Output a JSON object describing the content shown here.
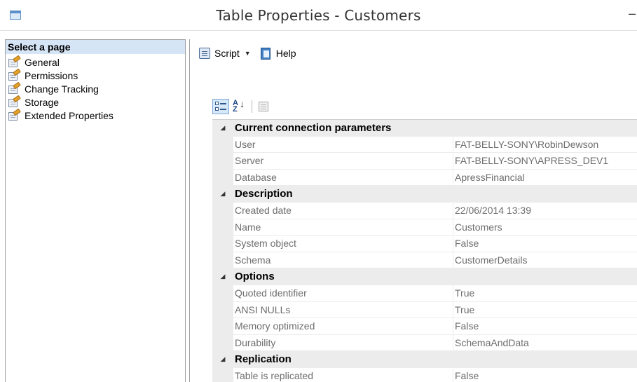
{
  "window": {
    "title": "Table Properties - Customers",
    "minimize_glyph": "–"
  },
  "left_pane": {
    "header": "Select a page",
    "pages": [
      {
        "label": "General",
        "selected": true
      },
      {
        "label": "Permissions",
        "selected": false
      },
      {
        "label": "Change Tracking",
        "selected": false
      },
      {
        "label": "Storage",
        "selected": false
      },
      {
        "label": "Extended Properties",
        "selected": false
      }
    ]
  },
  "toolbar": {
    "script_label": "Script",
    "help_label": "Help"
  },
  "grid": {
    "categories": [
      {
        "label": "Current connection parameters",
        "rows": [
          {
            "name": "User",
            "value": "FAT-BELLY-SONY\\RobinDewson"
          },
          {
            "name": "Server",
            "value": "FAT-BELLY-SONY\\APRESS_DEV1"
          },
          {
            "name": "Database",
            "value": "ApressFinancial"
          }
        ]
      },
      {
        "label": "Description",
        "rows": [
          {
            "name": "Created date",
            "value": "22/06/2014 13:39"
          },
          {
            "name": "Name",
            "value": "Customers"
          },
          {
            "name": "System object",
            "value": "False"
          },
          {
            "name": "Schema",
            "value": "CustomerDetails"
          }
        ]
      },
      {
        "label": "Options",
        "rows": [
          {
            "name": "Quoted identifier",
            "value": "True"
          },
          {
            "name": "ANSI NULLs",
            "value": "True"
          },
          {
            "name": "Memory optimized",
            "value": "False"
          },
          {
            "name": "Durability",
            "value": "SchemaAndData"
          }
        ]
      },
      {
        "label": "Replication",
        "rows": [
          {
            "name": "Table is replicated",
            "value": "False"
          }
        ]
      }
    ]
  }
}
